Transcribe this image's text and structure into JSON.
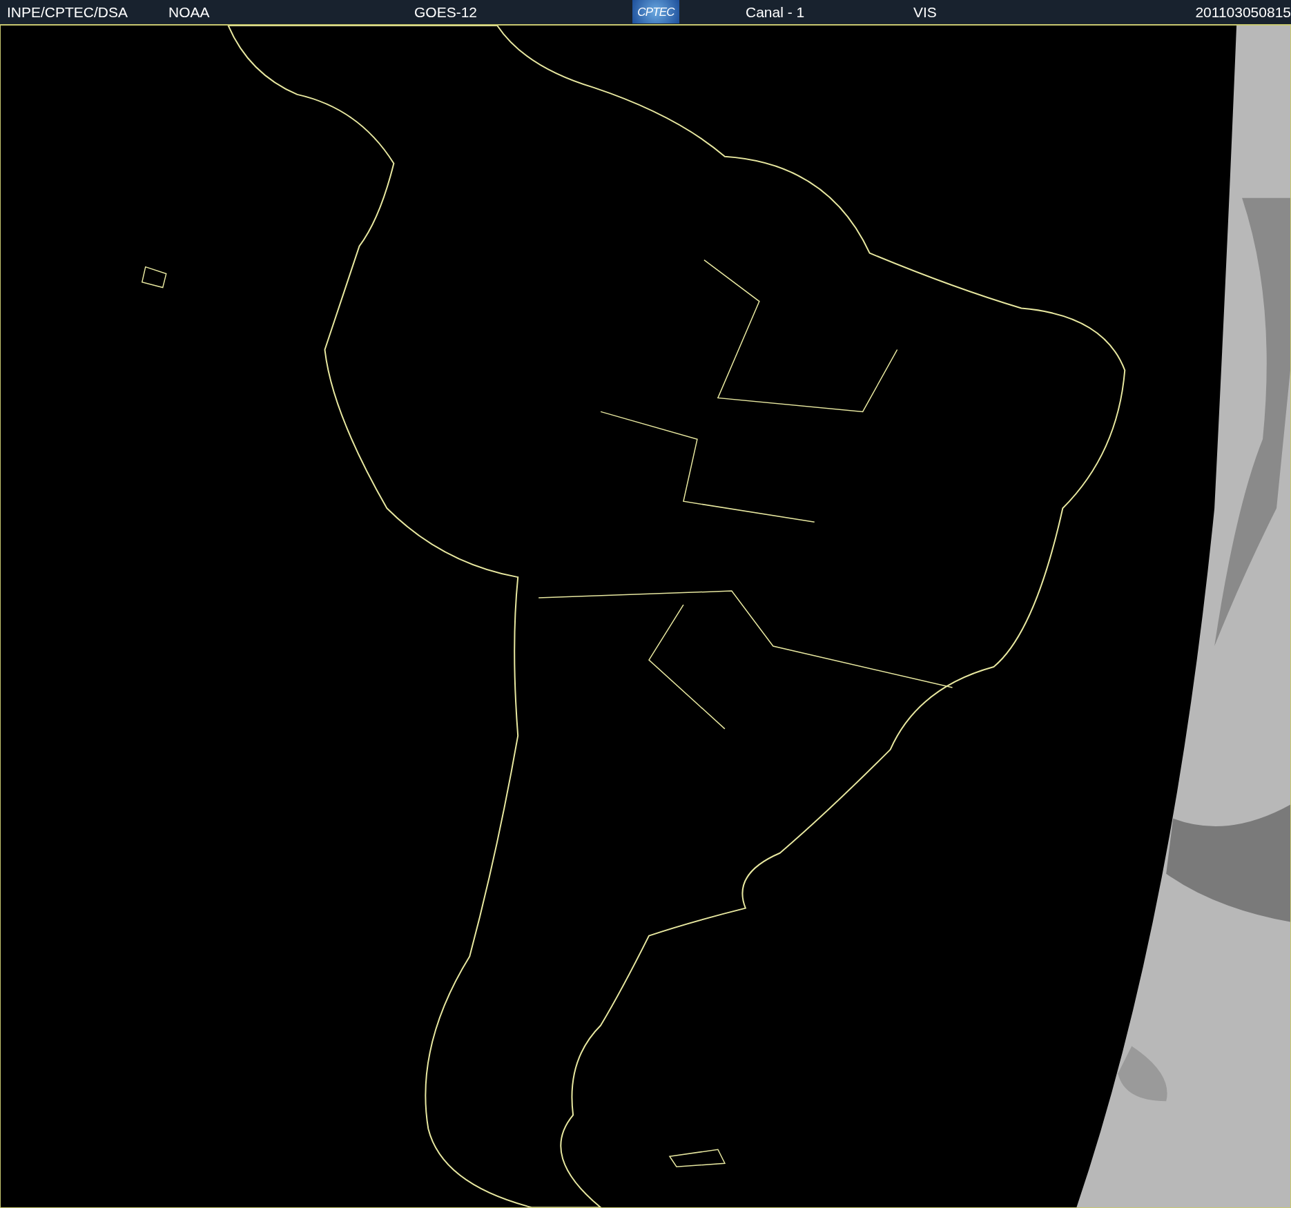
{
  "header": {
    "items": [
      {
        "kind": "text",
        "text": "INPE/CPTEC/DSA"
      },
      {
        "kind": "text",
        "text": "NOAA"
      },
      {
        "kind": "text",
        "text": "GOES-12"
      },
      {
        "kind": "logo",
        "text": "CPTEC"
      },
      {
        "kind": "text",
        "text": "Canal - 1"
      },
      {
        "kind": "text",
        "text": "VIS"
      },
      {
        "kind": "text",
        "text": "201103050815"
      }
    ]
  }
}
